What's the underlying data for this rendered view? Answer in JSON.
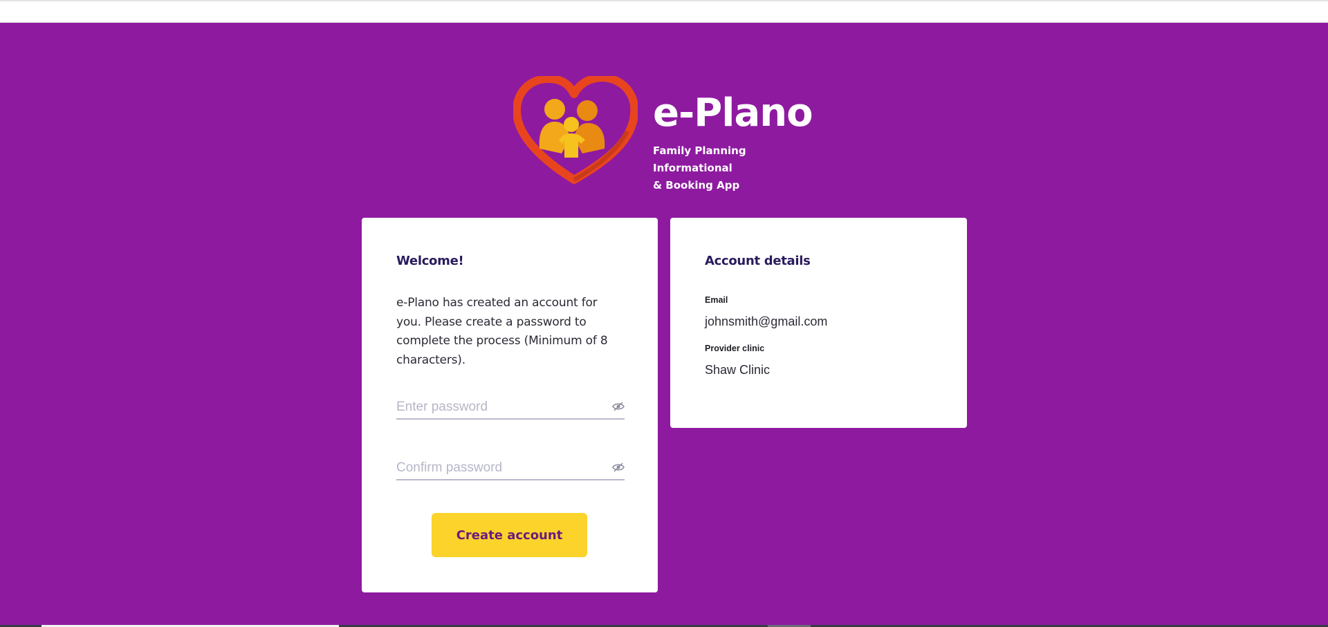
{
  "brand": {
    "name": "e-Plano",
    "tagline": "Family Planning Informational & Booking App",
    "tagline_line1": "Family Planning Informational",
    "tagline_line2": "& Booking App",
    "colors": {
      "background": "#8e1aa0",
      "button": "#fbd32b",
      "button_text": "#6c1a7e",
      "heading": "#2a1b5c",
      "heart": "#e8451f",
      "figures": "#f2a81a"
    }
  },
  "welcome": {
    "title": "Welcome!",
    "message": "e-Plano has created an account for you. Please create a password to complete the process (Minimum of 8 characters).",
    "password": {
      "value": "",
      "placeholder": "Enter password",
      "icon": "eye-slash-icon"
    },
    "confirm_password": {
      "value": "",
      "placeholder": "Confirm password",
      "icon": "eye-slash-icon"
    },
    "submit_label": "Create account"
  },
  "account": {
    "title": "Account details",
    "email_label": "Email",
    "email_value": "johnsmith@gmail.com",
    "clinic_label": "Provider clinic",
    "clinic_value": "Shaw Clinic"
  }
}
